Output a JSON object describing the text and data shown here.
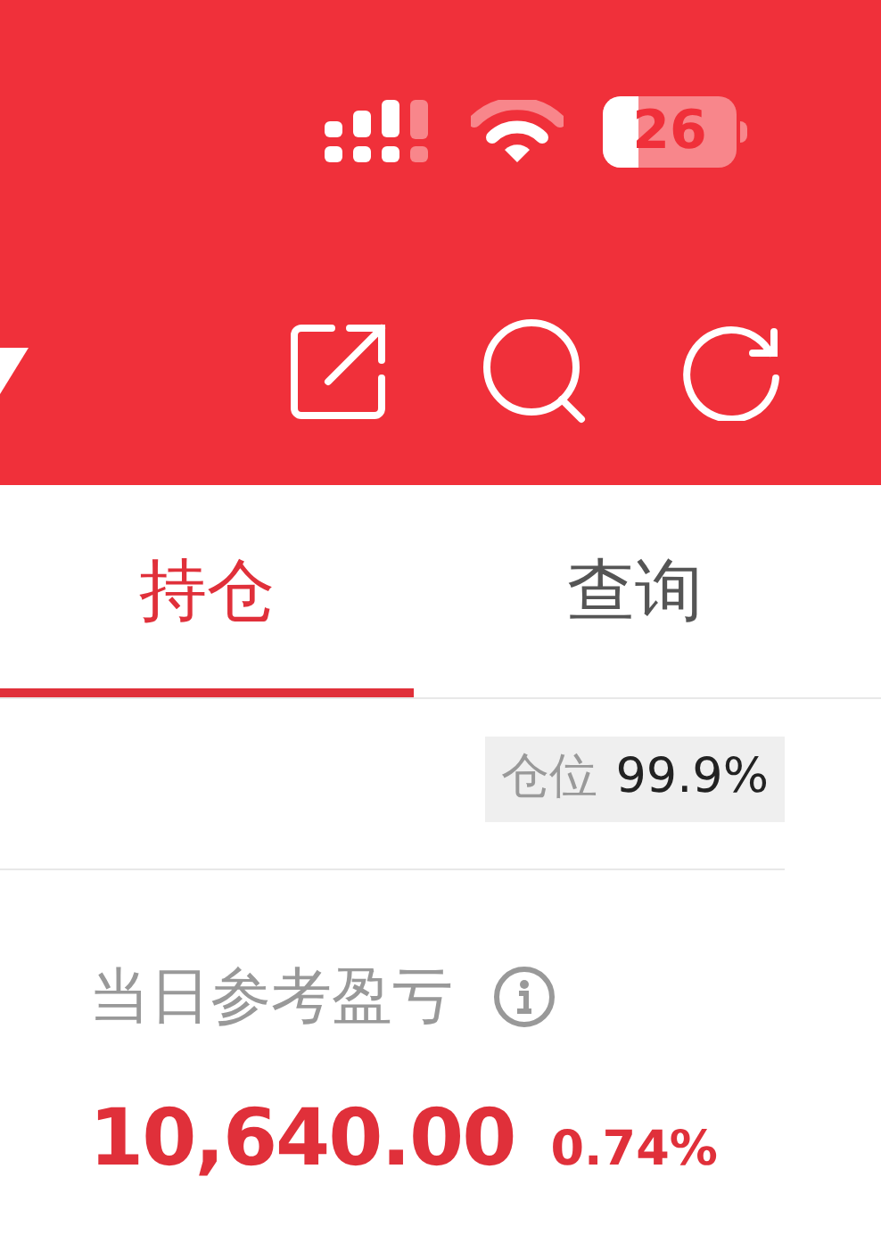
{
  "status_bar": {
    "battery": "26"
  },
  "tabs": [
    {
      "label": "持仓",
      "selected": true
    },
    {
      "label": "查询",
      "selected": false
    }
  ],
  "position": {
    "label": "仓位",
    "value": "99.9%"
  },
  "daily_pnl": {
    "label": "当日参考盈亏",
    "value": "10,640.00",
    "percent": "0.74%"
  }
}
